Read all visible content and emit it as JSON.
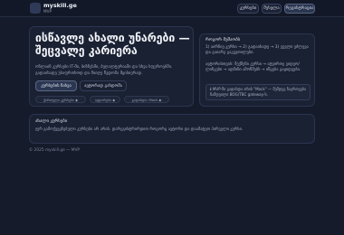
{
  "header": {
    "brand_title": "myskill.ge",
    "brand_sub": "MVP",
    "nav": [
      "კურსები",
      "შესვლა",
      "რეგისტრაცია"
    ]
  },
  "hero": {
    "title": "ისწავლე ახალი უნარები — შეცვალე კარიერა",
    "description": "ონლაინ კურსები IT-ში, ბიზნესში, ბუღალტერიაში და სხვა სფეროებში. გადაიხადე უსაფრთხოდ და მიიღე წვდომა მყისიერად.",
    "primary_button": "კურსების ნახვა",
    "secondary_button": "ავტორად გახდომა",
    "pills": [
      "ქართული კურსები ◆",
      "ავტორები ◆",
      "გადახდა: Mock ◆"
    ]
  },
  "side": {
    "title": "როგორ მუშაობს",
    "steps": [
      "1) აირჩიე კურსი → 2) გადაიხადე → 3) ვუვლი ეძლევა და გაიარე გაკვეთილები.",
      "ავტორისთვის: შექმენი კურსი → ატვირთე ვიდეო/ლინკები → ადმინი ამოწმებს → იწყება გაყიდვები."
    ],
    "note": "ℹ MVP-ში გადახდა არის \"Mock\" — შემდეგ ჩაერთვება ნამდვილი BOG/TBC gateway-ს."
  },
  "lower": {
    "title": "ახალი კურსები",
    "text": "ჯერ გამოქვეყნებული კურსები არ არის. დარეგისტრირდით როგორც ავტორი და დაამატეთ პირველი კურსი."
  },
  "footer": "© 2025 myskill.ge — MVP"
}
